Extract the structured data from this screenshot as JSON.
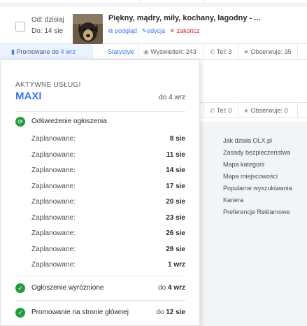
{
  "listing": {
    "from_label": "Od: dzisiaj",
    "to_label": "Do: 14 sie",
    "title": "Piękny, mądry, miły, kochany, łagodny - ...",
    "actions": {
      "preview": "podgląd",
      "edit": "edycja",
      "end": "zakończ"
    }
  },
  "statbar": {
    "promoted_prefix": "Promowane do",
    "promoted_date": "4 wrz",
    "stats": "Statystyki",
    "views": "Wyświetleń: 243",
    "phone": "Tel: 3",
    "observers": "Obserwuje: 35"
  },
  "listing2_stats": {
    "phone": "Tel: 0",
    "observers": "Obserwuje: 0"
  },
  "footer_links": [
    "Jak działa OLX.pl",
    "Zasady bezpieczeństwa",
    "Mapa kategorii",
    "Mapa miejscowości",
    "Popularne wyszukiwania",
    "Kariera",
    "Preferencje Reklamowe"
  ],
  "popup": {
    "header": "AKTYWNE USŁUGI",
    "package_name": "MAXI",
    "package_until": "do 4 wrz",
    "refresh": {
      "label": "Odświeżenie ogłoszenia"
    },
    "schedule": [
      {
        "label": "Zaplanowane:",
        "date": "8 sie"
      },
      {
        "label": "Zaplanowane:",
        "date": "11 sie"
      },
      {
        "label": "Zaplanowane:",
        "date": "14 sie"
      },
      {
        "label": "Zaplanowane:",
        "date": "17 sie"
      },
      {
        "label": "Zaplanowane:",
        "date": "20 sie"
      },
      {
        "label": "Zaplanowane:",
        "date": "23 sie"
      },
      {
        "label": "Zaplanowane:",
        "date": "26 sie"
      },
      {
        "label": "Zaplanowane:",
        "date": "29 sie"
      },
      {
        "label": "Zaplanowane:",
        "date": "1 wrz"
      }
    ],
    "featured": {
      "label": "Ogłoszenie wyróżnione",
      "until_prefix": "do",
      "until_date": "4 wrz"
    },
    "homepage": {
      "label": "Promowanie na stronie głównej",
      "until_prefix": "do",
      "until_date": "12 sie"
    }
  },
  "colors": {
    "accent": "#3a77ff",
    "success": "#1f9e3a",
    "danger": "#d9262c"
  }
}
